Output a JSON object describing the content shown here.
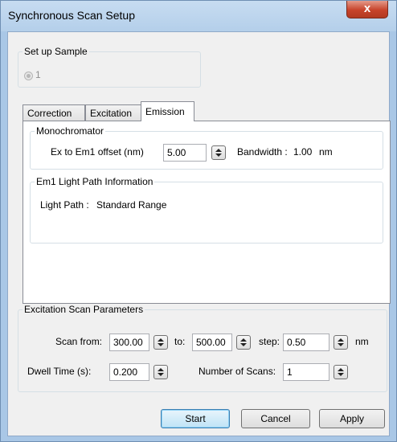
{
  "window": {
    "title": "Synchronous Scan Setup",
    "close_glyph": "x"
  },
  "sample": {
    "legend": "Set up Sample",
    "option_label": "1",
    "selected": true,
    "enabled": false
  },
  "tabs": [
    {
      "label": "Correction",
      "active": false
    },
    {
      "label": "Excitation",
      "active": false
    },
    {
      "label": "Emission",
      "active": true
    }
  ],
  "monochromator": {
    "legend": "Monochromator",
    "offset_label": "Ex to Em1 offset (nm)",
    "offset_value": "5.00",
    "bandwidth_label": "Bandwidth :",
    "bandwidth_value": "1.00",
    "bandwidth_unit": "nm"
  },
  "light_path": {
    "legend": "Em1 Light Path Information",
    "label": "Light Path :",
    "value": "Standard Range"
  },
  "scan_params": {
    "legend": "Excitation Scan Parameters",
    "scan_from_label": "Scan from:",
    "scan_from_value": "300.00",
    "to_label": "to:",
    "to_value": "500.00",
    "step_label": "step:",
    "step_value": "0.50",
    "unit": "nm",
    "dwell_label": "Dwell Time (s):",
    "dwell_value": "0.200",
    "num_scans_label": "Number of Scans:",
    "num_scans_value": "1"
  },
  "buttons": {
    "start": "Start",
    "cancel": "Cancel",
    "apply": "Apply"
  }
}
